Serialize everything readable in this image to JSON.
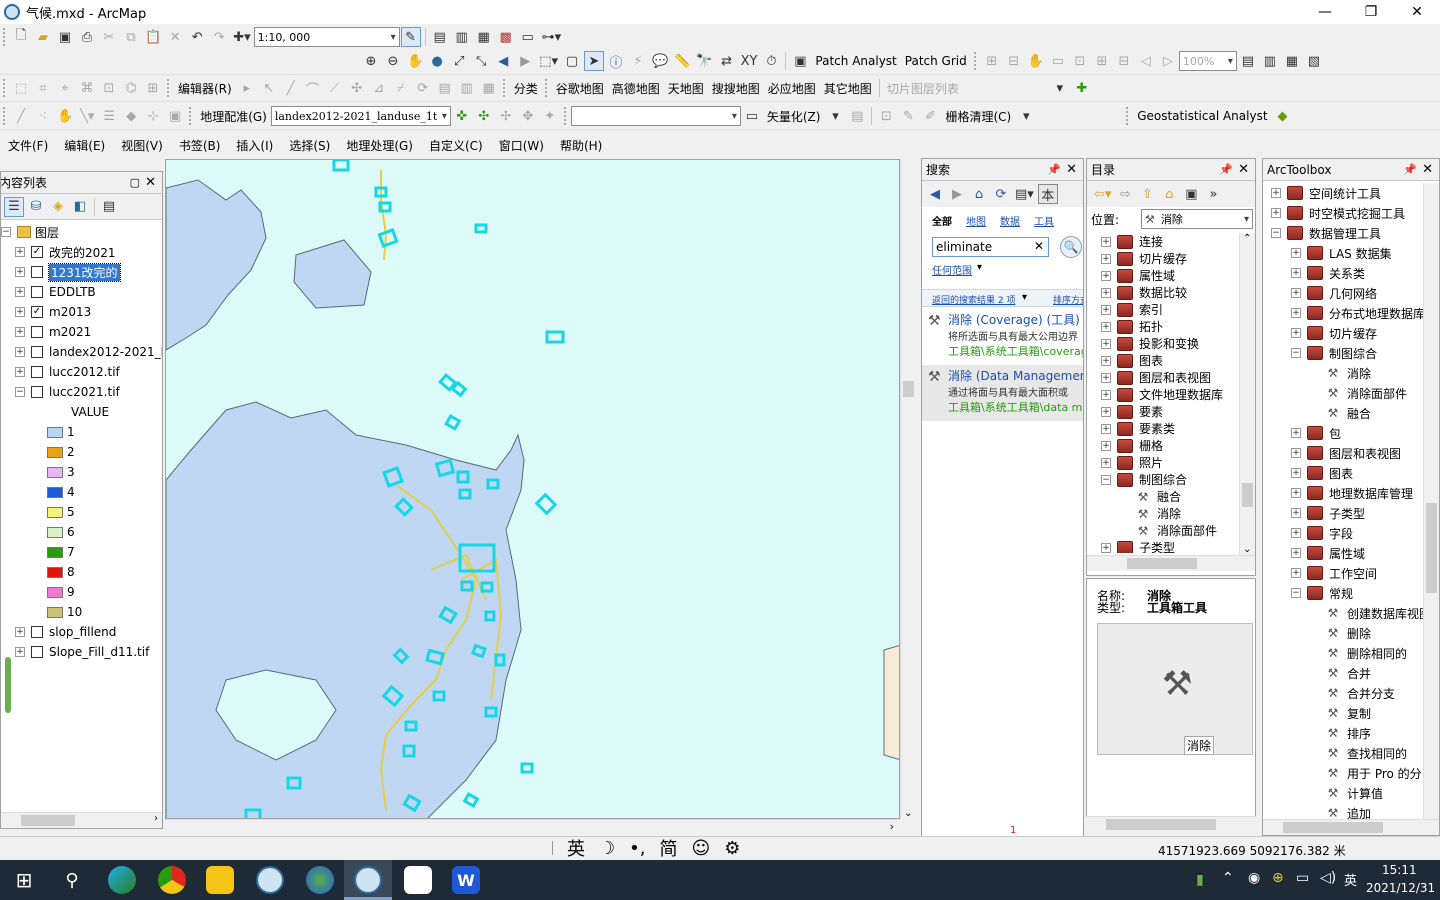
{
  "window": {
    "title": "气候.mxd - ArcMap",
    "minimize": "—",
    "maximize": "❐",
    "close": "✕"
  },
  "toolbar1": {
    "scale": "1:10, 000"
  },
  "toolbar2": {
    "patch_analyst": "Patch Analyst",
    "patch_grid": "Patch Grid",
    "zoom_percent": "100%"
  },
  "toolbar3": {
    "editor": "编辑器(R)",
    "classify": "分类",
    "items": [
      "谷歌地图",
      "高德地图",
      "天地图",
      "搜搜地图",
      "必应地图",
      "其它地图"
    ],
    "tile_list": "切片图层列表"
  },
  "toolbar4": {
    "georef": "地理配准(G)",
    "layer_combo": "landex2012-2021_landuse_1t",
    "vectorize": "矢量化(Z)",
    "raster_clean": "栅格清理(C)",
    "geostat": "Geostatistical Analyst"
  },
  "menu": [
    "文件(F)",
    "编辑(E)",
    "视图(V)",
    "书签(B)",
    "插入(I)",
    "选择(S)",
    "地理处理(G)",
    "自定义(C)",
    "窗口(W)",
    "帮助(H)"
  ],
  "toc": {
    "title": "内容列表",
    "root": "图层",
    "layers": [
      {
        "name": "改完的2021",
        "checked": "✓"
      },
      {
        "name": "1231改完的",
        "checked": ""
      },
      {
        "name": "EDDLTB",
        "checked": ""
      },
      {
        "name": "m2013",
        "checked": "✓"
      },
      {
        "name": "m2021",
        "checked": ""
      },
      {
        "name": "landex2012-2021_l",
        "checked": ""
      },
      {
        "name": "lucc2012.tif",
        "checked": ""
      },
      {
        "name": "lucc2021.tif",
        "checked": ""
      }
    ],
    "legend_header": "VALUE",
    "legend": [
      {
        "label": "1",
        "color": "#b3d7f5"
      },
      {
        "label": "2",
        "color": "#e8a317"
      },
      {
        "label": "3",
        "color": "#e9b5f2"
      },
      {
        "label": "4",
        "color": "#1f5ad6"
      },
      {
        "label": "5",
        "color": "#f5f37a"
      },
      {
        "label": "6",
        "color": "#d8f3c8"
      },
      {
        "label": "7",
        "color": "#2a9a12"
      },
      {
        "label": "8",
        "color": "#e21212"
      },
      {
        "label": "9",
        "color": "#f27ad0"
      },
      {
        "label": "10",
        "color": "#cbc27a"
      }
    ],
    "extra_layers": [
      {
        "name": "slop_fillend",
        "checked": ""
      },
      {
        "name": "Slope_Fill_d11.tif",
        "checked": ""
      }
    ]
  },
  "search": {
    "title": "搜索",
    "tabs": [
      "全部",
      "地图",
      "数据",
      "工具"
    ],
    "query": "eliminate",
    "scope": "任何范围",
    "results_link": "返回的搜索结果 2 项",
    "sort_link": "排序方式",
    "results": [
      {
        "title": "消除 (Coverage) (工具)",
        "desc": "将所选面与具有最大公用边界",
        "path": "工具箱\\系统工具箱\\coverage"
      },
      {
        "title": "消除 (Data Management)",
        "desc": "通过将面与具有最大面积或",
        "path": "工具箱\\系统工具箱\\data m"
      }
    ]
  },
  "catalog": {
    "title": "目录",
    "location_label": "位置:",
    "location_value": "消除",
    "items": [
      "连接",
      "切片缓存",
      "属性域",
      "数据比较",
      "索引",
      "拓扑",
      "投影和变换",
      "图表",
      "图层和表视图",
      "文件地理数据库",
      "要素",
      "要素类",
      "栅格",
      "照片",
      "制图综合"
    ],
    "sub_items": [
      "融合",
      "消除",
      "消除面部件"
    ],
    "last_item": "子类型",
    "info": {
      "name_label": "名称:",
      "name_value": "消除",
      "type_label": "类型:",
      "type_value": "工具箱工具",
      "preview_label": "消除"
    }
  },
  "toolbox": {
    "title": "ArcToolbox",
    "top": [
      "空间统计工具",
      "时空模式挖掘工具",
      "数据管理工具"
    ],
    "dm_children": [
      "LAS 数据集",
      "关系类",
      "几何网络",
      "分布式地理数据库",
      "切片缓存",
      "制图综合"
    ],
    "generalize_tools": [
      "消除",
      "消除面部件",
      "融合"
    ],
    "dm_children2": [
      "包",
      "图层和表视图",
      "图表",
      "地理数据库管理",
      "子类型",
      "字段",
      "属性域",
      "工作空间",
      "常规"
    ],
    "general_tools": [
      "创建数据库视图",
      "删除",
      "删除相同的",
      "合并",
      "合并分支",
      "复制",
      "排序",
      "查找相同的",
      "用于 Pro 的分",
      "计算值",
      "追加"
    ]
  },
  "status": {
    "coords": "41571923.669  5092176.382 米",
    "page_marker": "1"
  },
  "ime": {
    "lang": "英",
    "moon": "☽",
    "punct": "•,",
    "mode": "简",
    "emoji": "☺",
    "gear": "⚙"
  },
  "taskbar": {
    "time": "15:11",
    "date": "2021/12/31",
    "ime": "英"
  }
}
